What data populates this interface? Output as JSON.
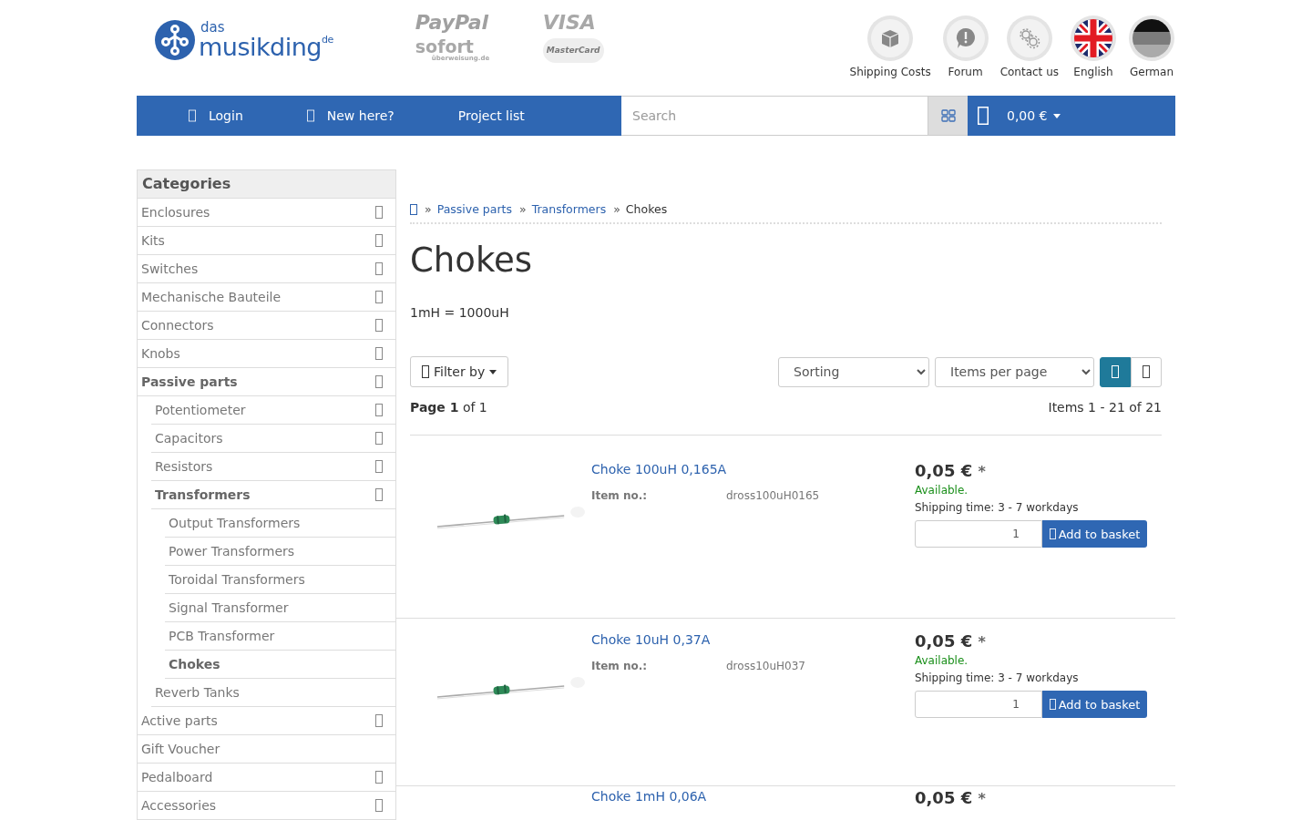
{
  "logo": {
    "small": "das",
    "name": "musikding",
    "suffix": "de"
  },
  "payments": [
    {
      "name": "PayPal"
    },
    {
      "name": "VISA"
    },
    {
      "name": "sofort",
      "sub": "überweisung.de"
    },
    {
      "name": "MasterCard"
    }
  ],
  "top_links": [
    {
      "label": "Shipping Costs"
    },
    {
      "label": "Forum"
    },
    {
      "label": "Contact us"
    },
    {
      "label": "English"
    },
    {
      "label": "German"
    }
  ],
  "nav": {
    "items": [
      {
        "label": "Login",
        "icon": true
      },
      {
        "label": "New here?",
        "icon": true
      },
      {
        "label": "Project list",
        "icon": false
      }
    ],
    "search": {
      "placeholder": "Search"
    },
    "cart_total": "0,00 €"
  },
  "sidebar": {
    "title": "Categories",
    "items": [
      {
        "label": "Enclosures",
        "active": false,
        "expandable": true
      },
      {
        "label": "Kits",
        "active": false,
        "expandable": true
      },
      {
        "label": "Switches",
        "active": false,
        "expandable": true
      },
      {
        "label": "Mechanische Bauteile",
        "active": false,
        "expandable": true
      },
      {
        "label": "Connectors",
        "active": false,
        "expandable": true
      },
      {
        "label": "Knobs",
        "active": false,
        "expandable": true
      },
      {
        "label": "Passive parts",
        "active": true,
        "expandable": true,
        "children": [
          {
            "label": "Potentiometer",
            "active": false,
            "expandable": true
          },
          {
            "label": "Capacitors",
            "active": false,
            "expandable": true
          },
          {
            "label": "Resistors",
            "active": false,
            "expandable": true
          },
          {
            "label": "Transformers",
            "active": true,
            "expandable": true,
            "children": [
              {
                "label": "Output Transformers",
                "active": false,
                "expandable": false
              },
              {
                "label": "Power Transformers",
                "active": false,
                "expandable": false
              },
              {
                "label": "Toroidal Transformers",
                "active": false,
                "expandable": false
              },
              {
                "label": "Signal Transformer",
                "active": false,
                "expandable": false
              },
              {
                "label": "PCB Transformer",
                "active": false,
                "expandable": false
              },
              {
                "label": "Chokes",
                "active": true,
                "expandable": false
              }
            ]
          },
          {
            "label": "Reverb Tanks",
            "active": false,
            "expandable": false
          }
        ]
      },
      {
        "label": "Active parts",
        "active": false,
        "expandable": true
      },
      {
        "label": "Gift Voucher",
        "active": false,
        "expandable": false
      },
      {
        "label": "Pedalboard",
        "active": false,
        "expandable": true
      },
      {
        "label": "Accessories",
        "active": false,
        "expandable": true
      }
    ]
  },
  "breadcrumb_separator": "»",
  "breadcrumb": [
    {
      "label": "Passive parts"
    },
    {
      "label": "Transformers"
    },
    {
      "label": "Chokes"
    }
  ],
  "title": "Chokes",
  "description": "1mH = 1000uH",
  "toolbar": {
    "filter": "Filter by",
    "sorting": "Sorting",
    "per_page": "Items per page",
    "views": [
      {
        "selected": true
      },
      {
        "selected": false
      }
    ]
  },
  "paging": {
    "page": "**Page 1** of 1",
    "items": "Items 1 - 21 of 21"
  },
  "products": [
    {
      "name": "Choke 100uH 0,165A",
      "item_no_label": "Item no.:",
      "item_no": "dross100uH0165",
      "price": "0,05 €",
      "price_note": "*",
      "availability": "Available.",
      "shipping": "Shipping time: 3 - 7 workdays",
      "quantity": "1",
      "button": "Add to basket"
    },
    {
      "name": "Choke 10uH 0,37A",
      "item_no_label": "Item no.:",
      "item_no": "dross10uH037",
      "price": "0,05 €",
      "price_note": "*",
      "availability": "Available.",
      "shipping": "Shipping time: 3 - 7 workdays",
      "quantity": "1",
      "button": "Add to basket"
    },
    {
      "name": "Choke 1mH 0,06A",
      "price": "0,05 €",
      "price_note": "*"
    }
  ]
}
